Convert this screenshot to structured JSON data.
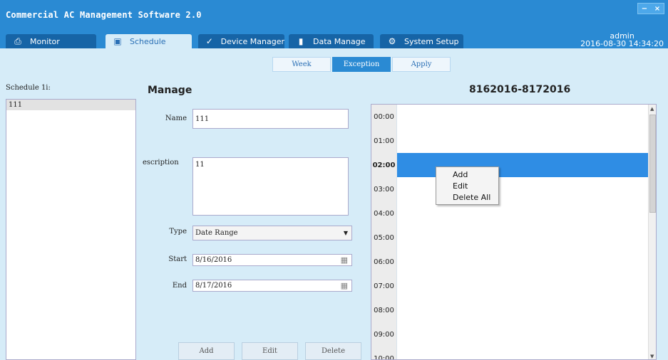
{
  "window": {
    "title": "Commercial AC Management Software 2.0",
    "controls": {
      "minimize": "−",
      "close": "×"
    }
  },
  "tabs": [
    {
      "label": "Monitor",
      "icon": "printer-icon",
      "active": false
    },
    {
      "label": "Schedule",
      "icon": "calendar-icon",
      "active": true
    },
    {
      "label": "Device Manager",
      "icon": "wrench-icon",
      "active": false
    },
    {
      "label": "Data Manage",
      "icon": "bar-chart-icon",
      "active": false
    },
    {
      "label": "System Setup",
      "icon": "gear-icon",
      "active": false
    }
  ],
  "user": {
    "name": "admin",
    "datetime": "2016-08-30 14:34:20"
  },
  "subtabs": {
    "week": "Week",
    "exception": "Exception",
    "apply": "Apply",
    "active": "exception"
  },
  "schedule_list": {
    "label": "Schedule 1i:",
    "items": [
      "111"
    ]
  },
  "manage": {
    "title": "Manage",
    "name_label": "Name",
    "name_value": "111",
    "description_label": "escription",
    "description_value": "11",
    "type_label": "Type",
    "type_value": "Date Range",
    "start_label": "Start",
    "start_value": "8/16/2016",
    "end_label": "End",
    "end_value": "8/17/2016",
    "buttons": {
      "add": "Add",
      "edit": "Edit",
      "delete": "Delete"
    }
  },
  "timeline": {
    "title": "8162016-8172016",
    "hours": [
      "00:00",
      "01:00",
      "02:00",
      "03:00",
      "04:00",
      "05:00",
      "06:00",
      "07:00",
      "08:00",
      "09:00",
      "10:00"
    ],
    "selected_hour": "02:00",
    "selected_color": "#2f8de4"
  },
  "context_menu": {
    "items": [
      "Add",
      "Edit",
      "Delete All"
    ]
  },
  "colors": {
    "header": "#2a8ad3",
    "tab_dark": "#1664a6",
    "background": "#d6ecf8"
  }
}
